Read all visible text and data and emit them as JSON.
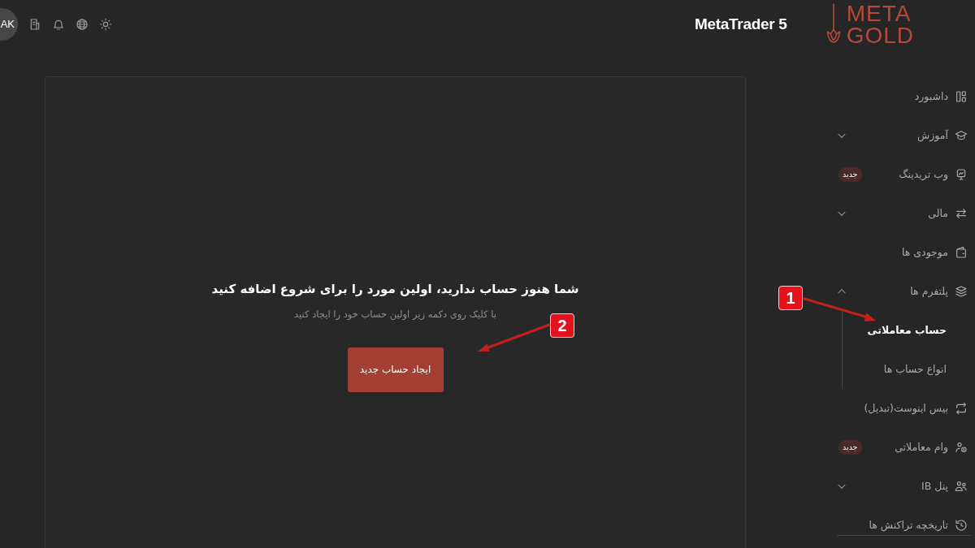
{
  "header": {
    "avatar": "AK",
    "app_title": "MetaTrader 5",
    "logo": [
      "META",
      "GOLD"
    ]
  },
  "empty_state": {
    "title": "شما هنوز حساب ندارید، اولین مورد را برای شروع اضافه کنید",
    "subtitle": "با کلیک روی دکمه زیر اولین حساب خود را ایجاد کنید",
    "button": "ایجاد حساب جدید"
  },
  "sidebar": {
    "items": [
      {
        "kind": "link",
        "label": "داشبورد"
      },
      {
        "kind": "group",
        "label": "آموزش",
        "expanded": false
      },
      {
        "kind": "link",
        "label": "وب تریدینگ",
        "badge": "جدید"
      },
      {
        "kind": "group",
        "label": "مالی",
        "expanded": false
      },
      {
        "kind": "link",
        "label": "موجودی ها"
      },
      {
        "kind": "group",
        "label": "پلتفرم ها",
        "expanded": true,
        "children": [
          {
            "label": "حساب معاملاتی",
            "selected": true
          },
          {
            "label": "انواع حساب ها",
            "selected": false
          }
        ]
      },
      {
        "kind": "link",
        "label": "بیس اینوست(تبدیل)"
      },
      {
        "kind": "link",
        "label": "وام معاملاتی",
        "badge": "جدید"
      },
      {
        "kind": "group",
        "label": "پنل IB",
        "expanded": false
      },
      {
        "kind": "link",
        "label": "تاریخچه تراکنش ها"
      }
    ]
  },
  "callouts": [
    {
      "number": "1"
    },
    {
      "number": "2"
    }
  ]
}
